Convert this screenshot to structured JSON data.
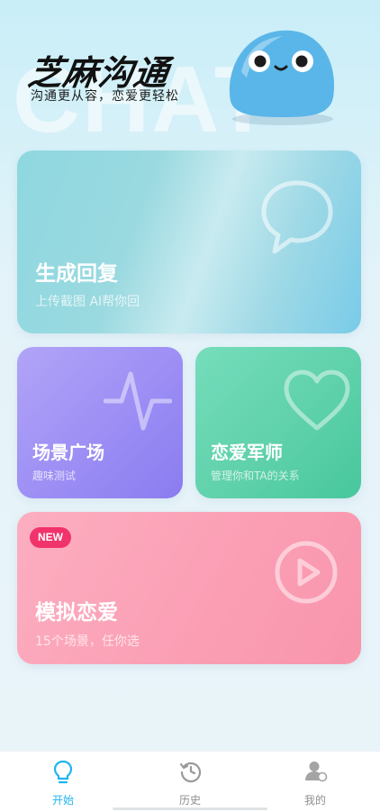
{
  "header": {
    "bg_word": "CHAT",
    "app_title": "芝麻沟通",
    "subtitle": "沟通更从容，恋爱更轻松"
  },
  "cards": {
    "reply": {
      "title": "生成回复",
      "subtitle": "上传截图 AI帮你回",
      "icon": "chat-bubble-icon"
    },
    "scene": {
      "title": "场景广场",
      "subtitle": "趣味测试",
      "icon": "pulse-icon"
    },
    "love": {
      "title": "恋爱军师",
      "subtitle": "管理你和TA的关系",
      "icon": "heart-icon"
    },
    "sim": {
      "badge": "NEW",
      "title": "模拟恋爱",
      "subtitle": "15个场景，任你选",
      "icon": "play-icon"
    }
  },
  "tabbar": {
    "active": "start",
    "accent_color": "#1fb4f0",
    "tabs": [
      {
        "id": "start",
        "label": "开始",
        "icon": "lightbulb-icon"
      },
      {
        "id": "history",
        "label": "历史",
        "icon": "history-icon"
      },
      {
        "id": "mine",
        "label": "我的",
        "icon": "user-icon"
      }
    ]
  }
}
